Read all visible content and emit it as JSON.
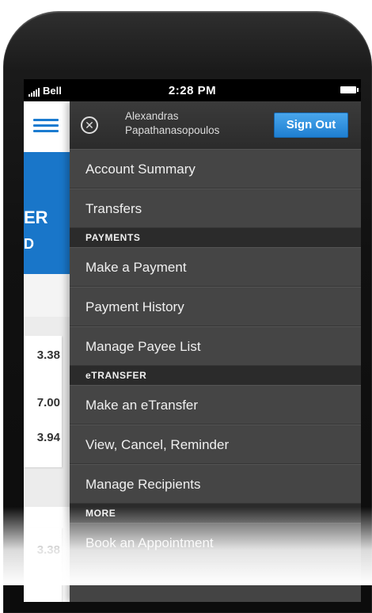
{
  "status_bar": {
    "carrier": "Bell",
    "time": "2:28 PM"
  },
  "background_app": {
    "banner_line1": "ER",
    "banner_line2": "D",
    "amounts": [
      "3.38",
      "7.00",
      "3.94",
      "3.38"
    ]
  },
  "drawer": {
    "user_name_line1": "Alexandras",
    "user_name_line2": "Papathanasopoulos",
    "signout_label": "Sign Out",
    "items": [
      {
        "kind": "item",
        "label": "Account Summary"
      },
      {
        "kind": "item",
        "label": "Transfers"
      },
      {
        "kind": "section",
        "label": "PAYMENTS"
      },
      {
        "kind": "item",
        "label": "Make a Payment"
      },
      {
        "kind": "item",
        "label": "Payment History"
      },
      {
        "kind": "item",
        "label": "Manage Payee List"
      },
      {
        "kind": "section",
        "label": "eTRANSFER"
      },
      {
        "kind": "item",
        "label": "Make an eTransfer"
      },
      {
        "kind": "item",
        "label": "View, Cancel, Reminder"
      },
      {
        "kind": "item",
        "label": "Manage Recipients"
      },
      {
        "kind": "section",
        "label": "MORE"
      },
      {
        "kind": "item",
        "label": "Book an Appointment"
      }
    ]
  },
  "colors": {
    "accent_blue": "#1b7bd0",
    "drawer_bg": "#444444",
    "section_bg": "#2b2b2b"
  }
}
